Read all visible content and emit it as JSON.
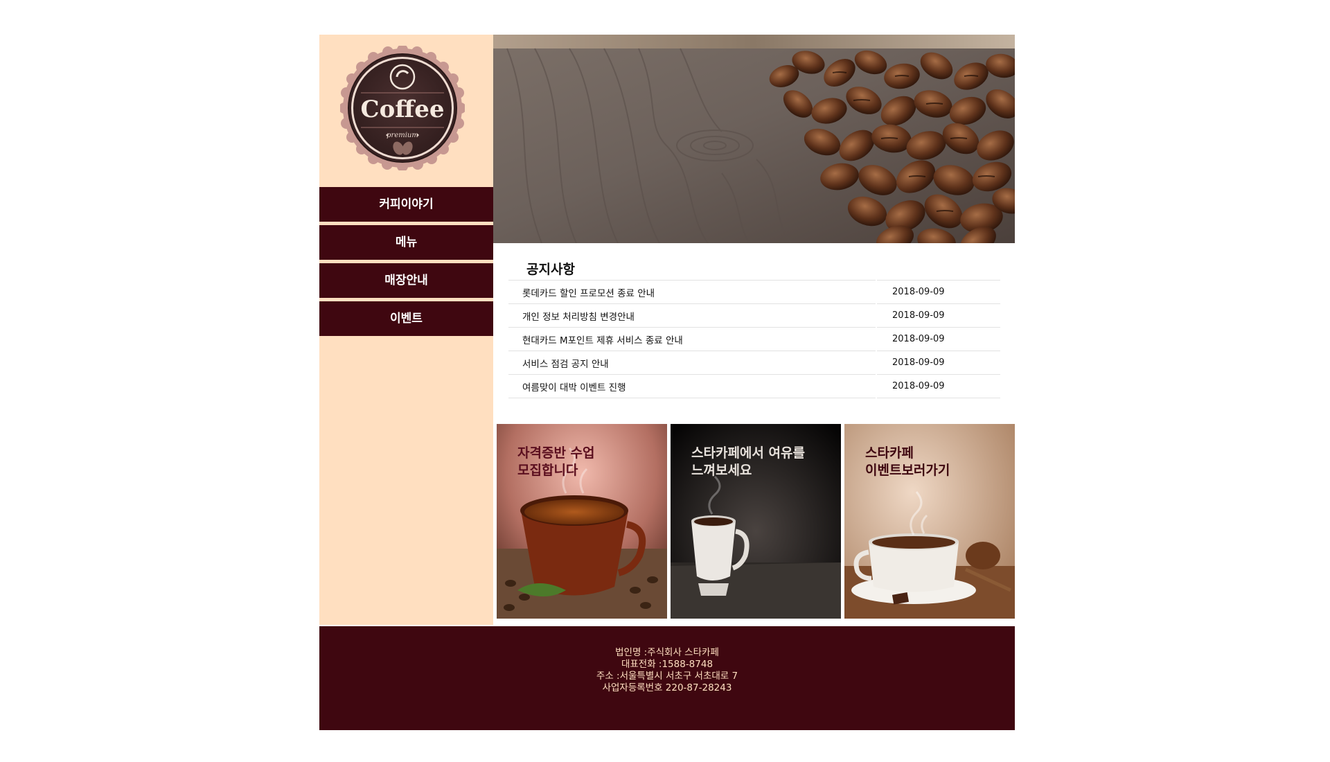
{
  "logo": {
    "text": "Coffee",
    "subtext": "premium"
  },
  "nav": {
    "items": [
      {
        "label": "커피이야기"
      },
      {
        "label": "메뉴"
      },
      {
        "label": "매장안내"
      },
      {
        "label": "이벤트"
      }
    ]
  },
  "notice": {
    "title": "공지사항",
    "rows": [
      {
        "title": "롯데카드 할인 프로모션 종료 안내",
        "date": "2018-09-09"
      },
      {
        "title": "개인 정보 처리방침 변경안내",
        "date": "2018-09-09"
      },
      {
        "title": "현대카드 M포인트 제휴 서비스 종료 안내",
        "date": "2018-09-09"
      },
      {
        "title": "서비스 점검 공지 안내",
        "date": "2018-09-09"
      },
      {
        "title": "여름맞이 대박 이벤트 진행",
        "date": "2018-09-09"
      }
    ]
  },
  "banners": [
    {
      "caption": "자격증반 수업\n모집합니다",
      "color": "#5a0e1e"
    },
    {
      "caption": "스타카페에서 여유를\n느껴보세요",
      "color": "#e8e2dc"
    },
    {
      "caption": "스타카페\n이벤트보러가기",
      "color": "#3f0710"
    }
  ],
  "footer": {
    "company": "법인명 :주식회사 스타카페",
    "phone": "대표전화 :1588-8748",
    "address": "주소 :서울특별시 서초구 서초대로 7",
    "registration": "사업자등록번호 220-87-28243"
  },
  "colors": {
    "sidebar_bg": "#ffdfc0",
    "brand_dark": "#3f0710"
  }
}
